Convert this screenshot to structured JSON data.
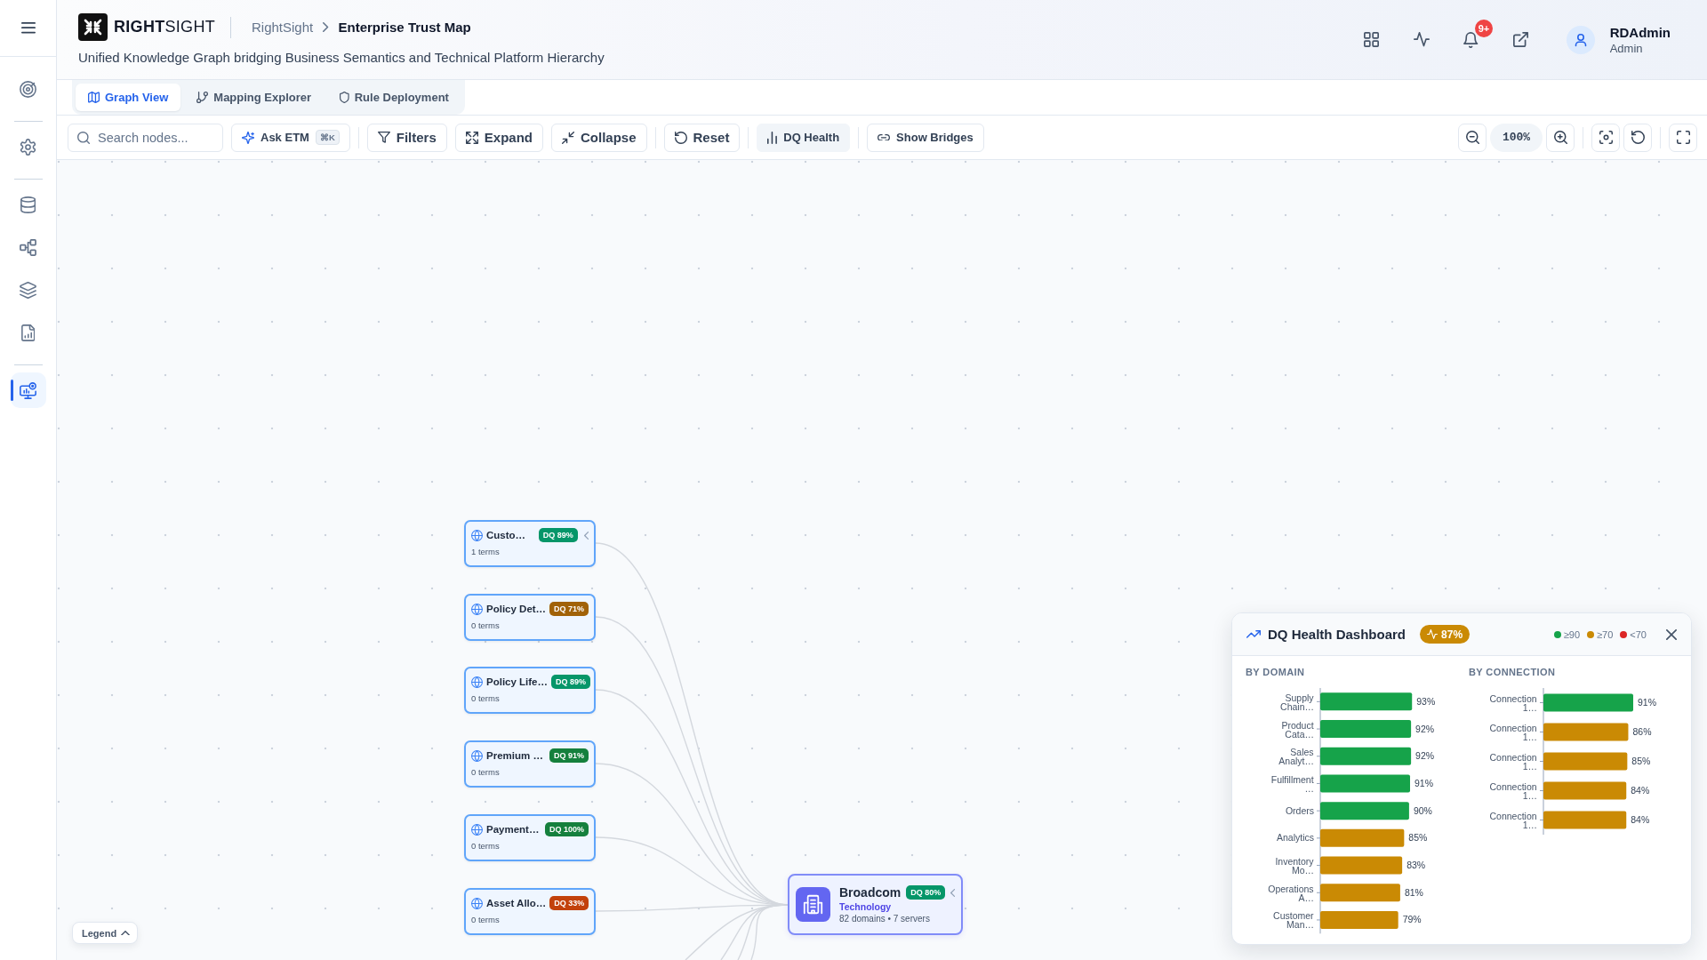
{
  "sidebar": {
    "groups": [
      {
        "items": [
          {
            "selected": false
          }
        ]
      },
      {
        "items": [
          {
            "selected": false
          }
        ]
      },
      {
        "items": [
          {
            "selected": false
          },
          {
            "selected": false
          },
          {
            "selected": false
          },
          {
            "selected": false
          }
        ]
      },
      {
        "items": [
          {
            "selected": true
          }
        ]
      }
    ]
  },
  "header": {
    "brand": "**RIGHT**SIGHT",
    "breadcrumb": [
      {
        "label": "RightSight",
        "current": false
      },
      {
        "label": "Enterprise Trust Map",
        "current": true
      }
    ],
    "subtitle": "Unified Knowledge Graph bridging Business Semantics and Technical Platform Hierarchy",
    "notifications": "9+",
    "user": {
      "name": "RDAdmin",
      "role": "Admin"
    }
  },
  "tabs": [
    {
      "label": "Graph View",
      "selected": true
    },
    {
      "label": "Mapping Explorer",
      "selected": false
    },
    {
      "label": "Rule Deployment",
      "selected": false
    }
  ],
  "toolbar": {
    "search": {
      "placeholder": "Search nodes..."
    },
    "groups": [
      {
        "buttons": [
          {
            "label": "Ask ETM",
            "shortcut": "⌘K",
            "on": false
          }
        ]
      },
      {
        "buttons": [
          {
            "label": "Filters",
            "on": false
          },
          {
            "label": "Expand",
            "on": false
          },
          {
            "label": "Collapse",
            "on": false
          }
        ]
      },
      {
        "buttons": [
          {
            "label": "Reset",
            "on": false
          }
        ]
      },
      {
        "buttons": [
          {
            "label": "DQ Health",
            "on": true
          }
        ]
      },
      {
        "buttons": [
          {
            "label": "Show Bridges",
            "on": false
          }
        ]
      }
    ],
    "zoom": "100%"
  },
  "graph": {
    "nodes": [
      {
        "title": "Custo…",
        "badge": "DQ 89%",
        "color": "#059669",
        "subtitle": "1 terms",
        "expanded": true
      },
      {
        "title": "Policy Det…",
        "badge": "DQ 71%",
        "color": "#a16207",
        "subtitle": "0 terms",
        "expanded": false
      },
      {
        "title": "Policy Life…",
        "badge": "DQ 89%",
        "color": "#059669",
        "subtitle": "0 terms",
        "expanded": false
      },
      {
        "title": "Premium …",
        "badge": "DQ 91%",
        "color": "#15803d",
        "subtitle": "0 terms",
        "expanded": false
      },
      {
        "title": "Payment…",
        "badge": "DQ 100%",
        "color": "#15803d",
        "subtitle": "0 terms",
        "expanded": false
      },
      {
        "title": "Asset Allo…",
        "badge": "DQ 33%",
        "color": "#c2410c",
        "subtitle": "0 terms",
        "expanded": false
      }
    ],
    "hub": {
      "title": "Broadcom",
      "badge": "DQ 80%",
      "color": "#059669",
      "category": "Technology",
      "meta": "82 domains • 7 servers",
      "expanded": true
    }
  },
  "dashboard": {
    "title": "DQ Health Dashboard",
    "score": "87%",
    "legend": [
      {
        "label": "≥90",
        "color": "#16a34a"
      },
      {
        "label": "≥70",
        "color": "#ca8a04"
      },
      {
        "label": "<70",
        "color": "#dc2626"
      }
    ],
    "sections": [
      {
        "title": "BY DOMAIN",
        "chart_data": {
          "type": "bar",
          "orientation": "horizontal",
          "categories": [
            "Supply Chain…",
            "Product Cata…",
            "Sales Analyt…",
            "Fulfillment …",
            "Orders",
            "Analytics",
            "Inventory Mo…",
            "Operations A…",
            "Customer Man…"
          ],
          "series": [
            {
              "color": "#16a34a",
              "values": [
                93,
                92,
                92,
                91,
                90,
                null,
                null,
                null,
                null
              ],
              "value_labels": [
                "93%",
                "92%",
                "92%",
                "91%",
                "90%",
                null,
                null,
                null,
                null
              ]
            },
            {
              "color": "#ca8a04",
              "values": [
                null,
                null,
                null,
                null,
                null,
                85,
                83,
                81,
                79
              ],
              "value_labels": [
                null,
                null,
                null,
                null,
                null,
                "85%",
                "83%",
                "81%",
                "79%"
              ]
            }
          ]
        }
      },
      {
        "title": "BY CONNECTION",
        "chart_data": {
          "type": "bar",
          "orientation": "horizontal",
          "categories": [
            "Connection 1…",
            "Connection 1…",
            "Connection 1…",
            "Connection 1…",
            "Connection 1…"
          ],
          "series": [
            {
              "color": "#16a34a",
              "values": [
                91,
                null,
                null,
                null,
                null
              ],
              "value_labels": [
                "91%",
                null,
                null,
                null,
                null
              ]
            },
            {
              "color": "#ca8a04",
              "values": [
                null,
                86,
                85,
                84,
                84
              ],
              "value_labels": [
                null,
                "86%",
                "85%",
                "84%",
                "84%"
              ]
            }
          ]
        }
      }
    ]
  },
  "legend_button": {
    "label": "Legend",
    "expanded": false
  }
}
